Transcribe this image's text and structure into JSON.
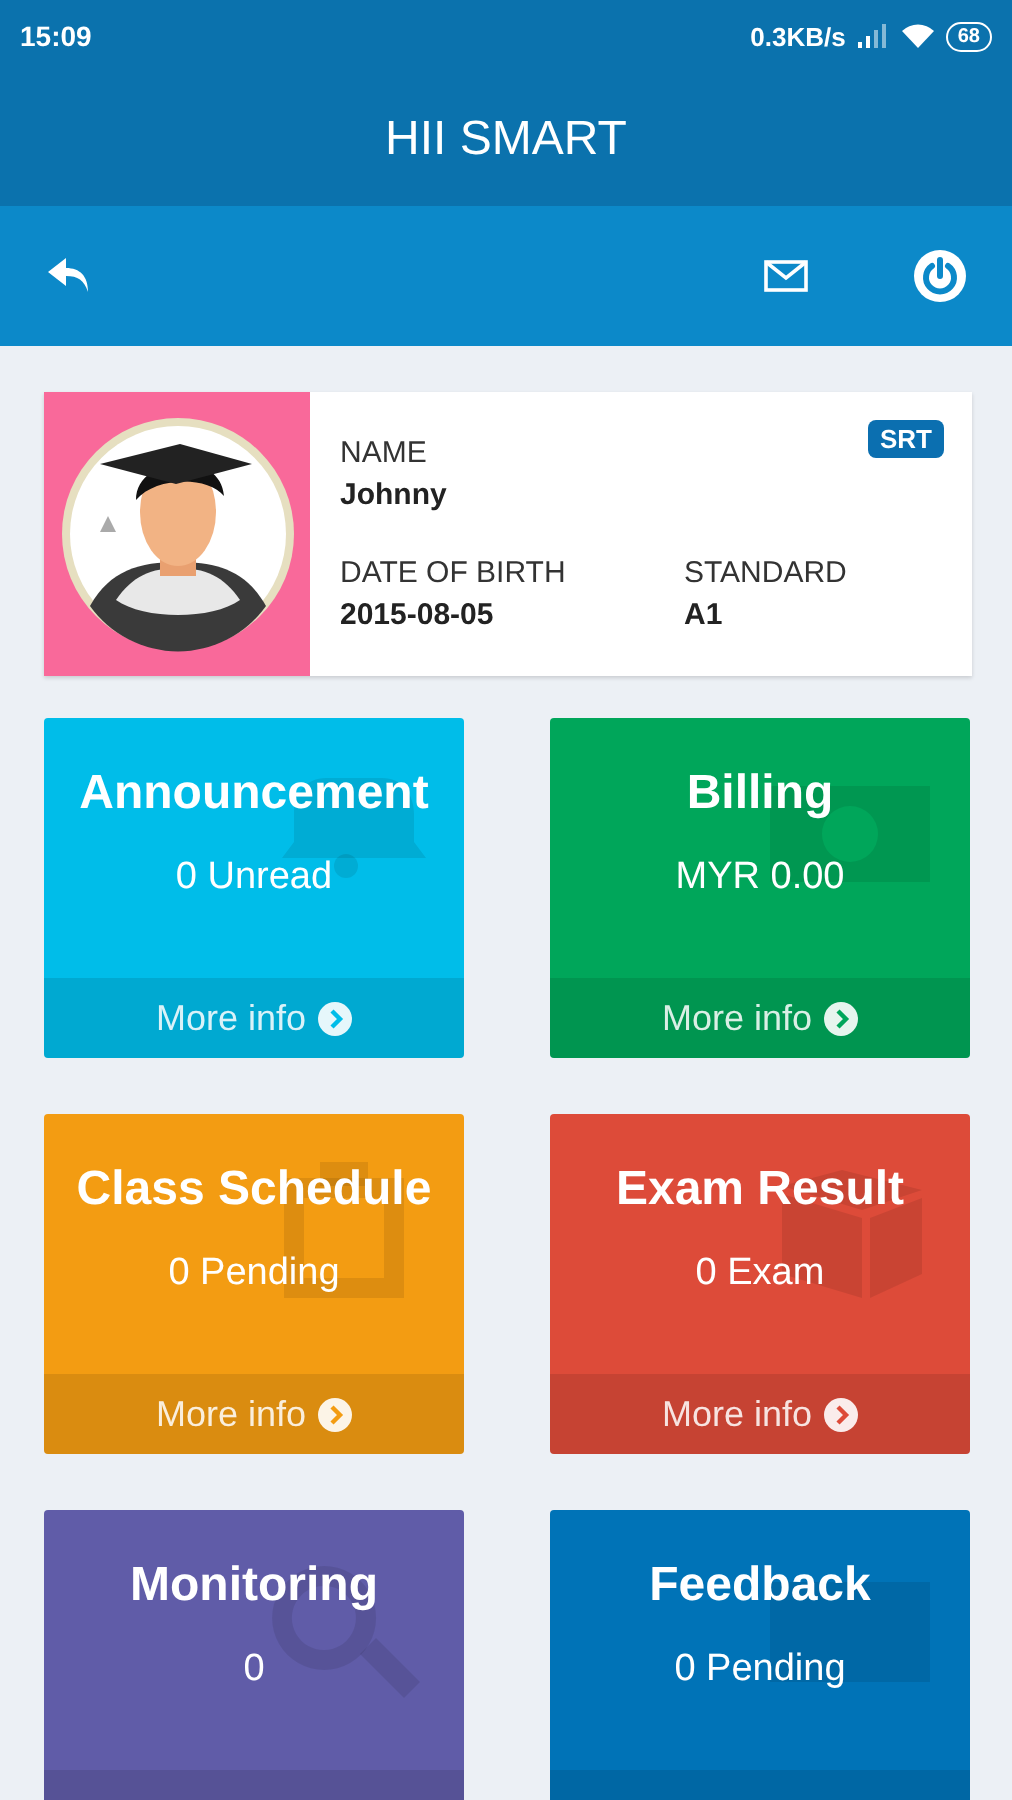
{
  "status_bar": {
    "time": "15:09",
    "speed": "0.3KB/s",
    "battery": "68"
  },
  "app_bar": {
    "title": "HII SMART"
  },
  "profile": {
    "name_label": "NAME",
    "name": "Johnny",
    "badge": "SRT",
    "dob_label": "DATE OF BIRTH",
    "dob": "2015-08-05",
    "standard_label": "STANDARD",
    "standard": "A1"
  },
  "tiles": [
    {
      "title": "Announcement",
      "value": "0 Unread",
      "more_info": "More info",
      "color": "#00bde9"
    },
    {
      "title": "Billing",
      "value": "MYR 0.00",
      "more_info": "More info",
      "color": "#00a65a"
    },
    {
      "title": "Class Schedule",
      "value": "0 Pending",
      "more_info": "More info",
      "color": "#f39c12"
    },
    {
      "title": "Exam Result",
      "value": "0 Exam",
      "more_info": "More info",
      "color": "#dd4b39"
    },
    {
      "title": "Monitoring",
      "value": "0",
      "color": "#605ca8"
    },
    {
      "title": "Feedback",
      "value": "0 Pending",
      "color": "#0073b7"
    }
  ]
}
